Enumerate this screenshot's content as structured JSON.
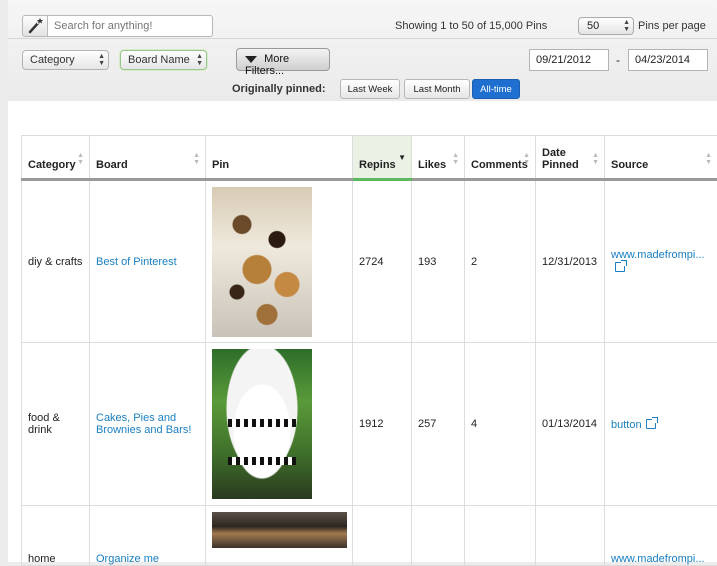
{
  "toolbar": {
    "search_placeholder": "Search for anything!",
    "showing_text": "Showing 1 to 50 of 15,000 Pins",
    "per_page_value": "50",
    "per_page_label": "Pins per page",
    "category_select": "Category",
    "board_select": "Board Name",
    "more_filters": "More Filters...",
    "date_from": "09/21/2012",
    "date_to": "04/23/2014",
    "date_separator": "-",
    "originally_pinned_label": "Originally pinned:",
    "period_buttons": [
      "Last Week",
      "Last Month",
      "All-time"
    ],
    "active_period": "All-time"
  },
  "table": {
    "columns": [
      "Category",
      "Board",
      "Pin",
      "Repins",
      "Likes",
      "Comments",
      "Date Pinned",
      "Source"
    ],
    "sorted_column": "Repins",
    "sort_direction": "descending",
    "rows": [
      {
        "category": "diy & crafts",
        "board": "Best of Pinterest",
        "repins": "2724",
        "likes": "193",
        "comments": "2",
        "date": "12/31/2013",
        "source": "www.madefrompi..."
      },
      {
        "category": "food & drink",
        "board": "Cakes, Pies and Brownies and Bars!",
        "repins": "1912",
        "likes": "257",
        "comments": "4",
        "date": "01/13/2014",
        "source": "button"
      },
      {
        "category": "home",
        "board": "Organize me",
        "repins": "",
        "likes": "",
        "comments": "",
        "date": "",
        "source": "www.madefrompi..."
      }
    ]
  },
  "colors": {
    "link": "#1a7fc1",
    "active_button": "#1e6fd0",
    "sorted_header": "#5cb85c"
  }
}
